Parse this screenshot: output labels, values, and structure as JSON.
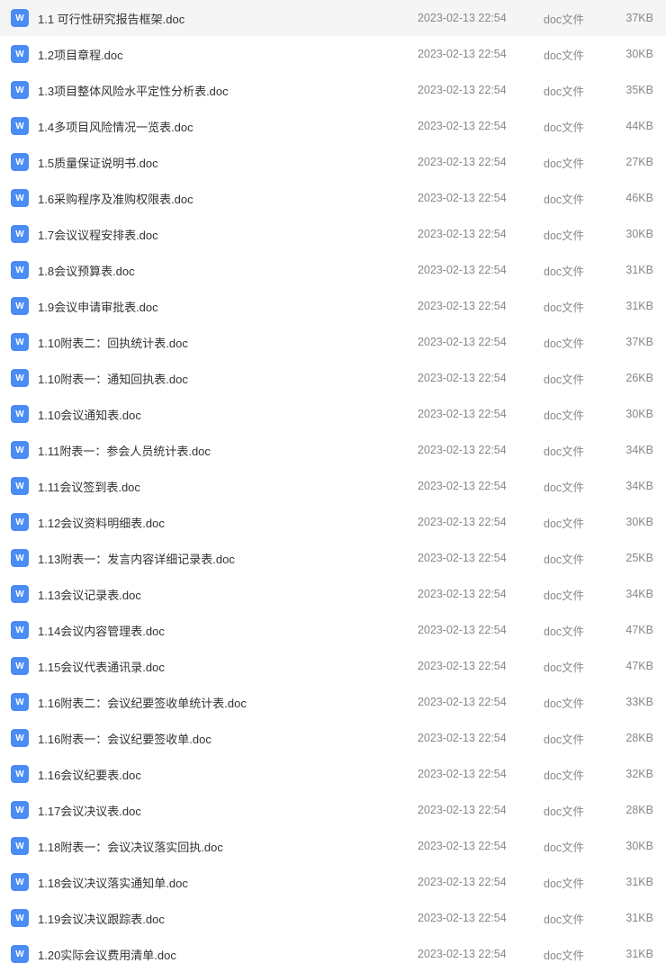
{
  "iconLabel": "W",
  "files": [
    {
      "name": "1.1 可行性研究报告框架.doc",
      "date": "2023-02-13 22:54",
      "type": "doc文件",
      "size": "37KB"
    },
    {
      "name": "1.2项目章程.doc",
      "date": "2023-02-13 22:54",
      "type": "doc文件",
      "size": "30KB"
    },
    {
      "name": "1.3项目整体风险水平定性分析表.doc",
      "date": "2023-02-13 22:54",
      "type": "doc文件",
      "size": "35KB"
    },
    {
      "name": "1.4多项目风险情况一览表.doc",
      "date": "2023-02-13 22:54",
      "type": "doc文件",
      "size": "44KB"
    },
    {
      "name": "1.5质量保证说明书.doc",
      "date": "2023-02-13 22:54",
      "type": "doc文件",
      "size": "27KB"
    },
    {
      "name": "1.6采购程序及准购权限表.doc",
      "date": "2023-02-13 22:54",
      "type": "doc文件",
      "size": "46KB"
    },
    {
      "name": "1.7会议议程安排表.doc",
      "date": "2023-02-13 22:54",
      "type": "doc文件",
      "size": "30KB"
    },
    {
      "name": "1.8会议预算表.doc",
      "date": "2023-02-13 22:54",
      "type": "doc文件",
      "size": "31KB"
    },
    {
      "name": "1.9会议申请审批表.doc",
      "date": "2023-02-13 22:54",
      "type": "doc文件",
      "size": "31KB"
    },
    {
      "name": "1.10附表二：回执统计表.doc",
      "date": "2023-02-13 22:54",
      "type": "doc文件",
      "size": "37KB"
    },
    {
      "name": "1.10附表一：通知回执表.doc",
      "date": "2023-02-13 22:54",
      "type": "doc文件",
      "size": "26KB"
    },
    {
      "name": "1.10会议通知表.doc",
      "date": "2023-02-13 22:54",
      "type": "doc文件",
      "size": "30KB"
    },
    {
      "name": "1.11附表一：参会人员统计表.doc",
      "date": "2023-02-13 22:54",
      "type": "doc文件",
      "size": "34KB"
    },
    {
      "name": "1.11会议签到表.doc",
      "date": "2023-02-13 22:54",
      "type": "doc文件",
      "size": "34KB"
    },
    {
      "name": "1.12会议资料明细表.doc",
      "date": "2023-02-13 22:54",
      "type": "doc文件",
      "size": "30KB"
    },
    {
      "name": "1.13附表一：发言内容详细记录表.doc",
      "date": "2023-02-13 22:54",
      "type": "doc文件",
      "size": "25KB"
    },
    {
      "name": "1.13会议记录表.doc",
      "date": "2023-02-13 22:54",
      "type": "doc文件",
      "size": "34KB"
    },
    {
      "name": "1.14会议内容管理表.doc",
      "date": "2023-02-13 22:54",
      "type": "doc文件",
      "size": "47KB"
    },
    {
      "name": "1.15会议代表通讯录.doc",
      "date": "2023-02-13 22:54",
      "type": "doc文件",
      "size": "47KB"
    },
    {
      "name": "1.16附表二：会议纪要签收单统计表.doc",
      "date": "2023-02-13 22:54",
      "type": "doc文件",
      "size": "33KB"
    },
    {
      "name": "1.16附表一：会议纪要签收单.doc",
      "date": "2023-02-13 22:54",
      "type": "doc文件",
      "size": "28KB"
    },
    {
      "name": "1.16会议纪要表.doc",
      "date": "2023-02-13 22:54",
      "type": "doc文件",
      "size": "32KB"
    },
    {
      "name": "1.17会议决议表.doc",
      "date": "2023-02-13 22:54",
      "type": "doc文件",
      "size": "28KB"
    },
    {
      "name": "1.18附表一：会议决议落实回执.doc",
      "date": "2023-02-13 22:54",
      "type": "doc文件",
      "size": "30KB"
    },
    {
      "name": "1.18会议决议落实通知单.doc",
      "date": "2023-02-13 22:54",
      "type": "doc文件",
      "size": "31KB"
    },
    {
      "name": "1.19会议决议跟踪表.doc",
      "date": "2023-02-13 22:54",
      "type": "doc文件",
      "size": "31KB"
    },
    {
      "name": "1.20实际会议费用清单.doc",
      "date": "2023-02-13 22:54",
      "type": "doc文件",
      "size": "31KB"
    }
  ]
}
